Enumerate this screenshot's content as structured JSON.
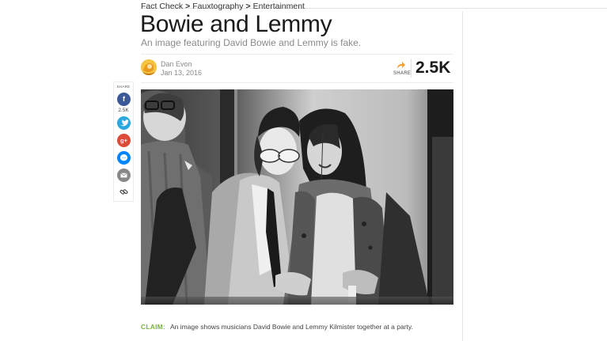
{
  "breadcrumb": {
    "items": [
      "Fact Check",
      "Fauxtography",
      "Entertainment"
    ],
    "separator": ">"
  },
  "article": {
    "title": "Bowie and Lemmy",
    "subtitle": "An image featuring David Bowie and Lemmy is fake.",
    "author": "Dan Evon",
    "date": "Jan 13, 2016"
  },
  "share": {
    "action_label": "SHARE",
    "total_count": "2.5K",
    "accent_color": "#f0a030"
  },
  "social_bar": {
    "label": "SHARE",
    "facebook_count": "2.5K",
    "buttons": [
      {
        "name": "facebook",
        "glyph": "f",
        "color": "#3b5998"
      },
      {
        "name": "twitter",
        "glyph": "t",
        "color": "#2ca7e0"
      },
      {
        "name": "google-plus",
        "glyph": "g+",
        "color": "#dd4b39"
      },
      {
        "name": "messenger",
        "glyph": "m",
        "color": "#0084ff"
      },
      {
        "name": "email",
        "glyph": "@",
        "color": "#888888"
      },
      {
        "name": "link",
        "glyph": "link",
        "color": "#333333"
      }
    ]
  },
  "claim": {
    "label": "CLAIM:",
    "text": "An image shows musicians David Bowie and Lemmy Kilmister together at a party.",
    "label_color": "#7bb341"
  },
  "photo": {
    "icon": "black-and-white-photo"
  }
}
